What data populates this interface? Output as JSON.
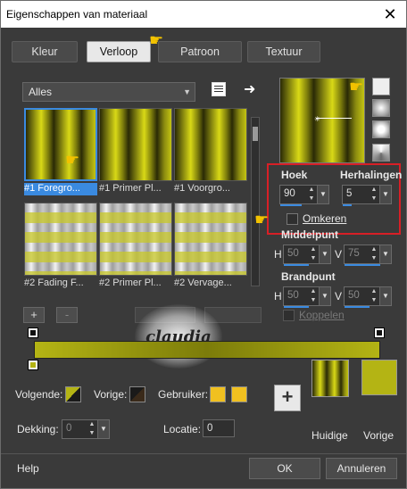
{
  "window": {
    "title": "Eigenschappen van materiaal",
    "close": "✕"
  },
  "tabs": [
    {
      "label": "Kleur"
    },
    {
      "label": "Verloop"
    },
    {
      "label": "Patroon"
    },
    {
      "label": "Textuur"
    }
  ],
  "gradient_list": {
    "filter": "Alles",
    "items": [
      {
        "label": "#1 Foregro..."
      },
      {
        "label": "#1 Primer Pl..."
      },
      {
        "label": "#1 Voorgro..."
      },
      {
        "label": "#2 Fading F..."
      },
      {
        "label": "#2 Primer Pl..."
      },
      {
        "label": "#2 Vervage..."
      }
    ],
    "add": "+",
    "remove": "-"
  },
  "watermark": {
    "text": "claudia"
  },
  "settings": {
    "angle_label": "Hoek",
    "angle_value": "90",
    "repeats_label": "Herhalingen",
    "repeats_value": "5",
    "invert_label": "Omkeren",
    "center_label": "Middelpunt",
    "center_h_label": "H",
    "center_h_value": "50",
    "center_v_label": "V",
    "center_v_value": "75",
    "focal_label": "Brandpunt",
    "focal_h_label": "H",
    "focal_h_value": "50",
    "focal_v_label": "V",
    "focal_v_value": "50",
    "link_label": "Koppelen"
  },
  "editor": {
    "next_label": "Volgende:",
    "prev_label": "Vorige:",
    "user_label": "Gebruiker:",
    "opacity_label": "Dekking:",
    "opacity_value": "0",
    "location_label": "Locatie:",
    "location_value": "0",
    "current_label": "Huidige",
    "previous_label": "Vorige",
    "add": "+"
  },
  "colors": {
    "accent": "#3a8ae0",
    "highlight_box": "#d81f26",
    "swatch_yellow": "#b4b414",
    "user_color": "#f0c020"
  },
  "footer": {
    "help": "Help",
    "ok": "OK",
    "cancel": "Annuleren"
  }
}
